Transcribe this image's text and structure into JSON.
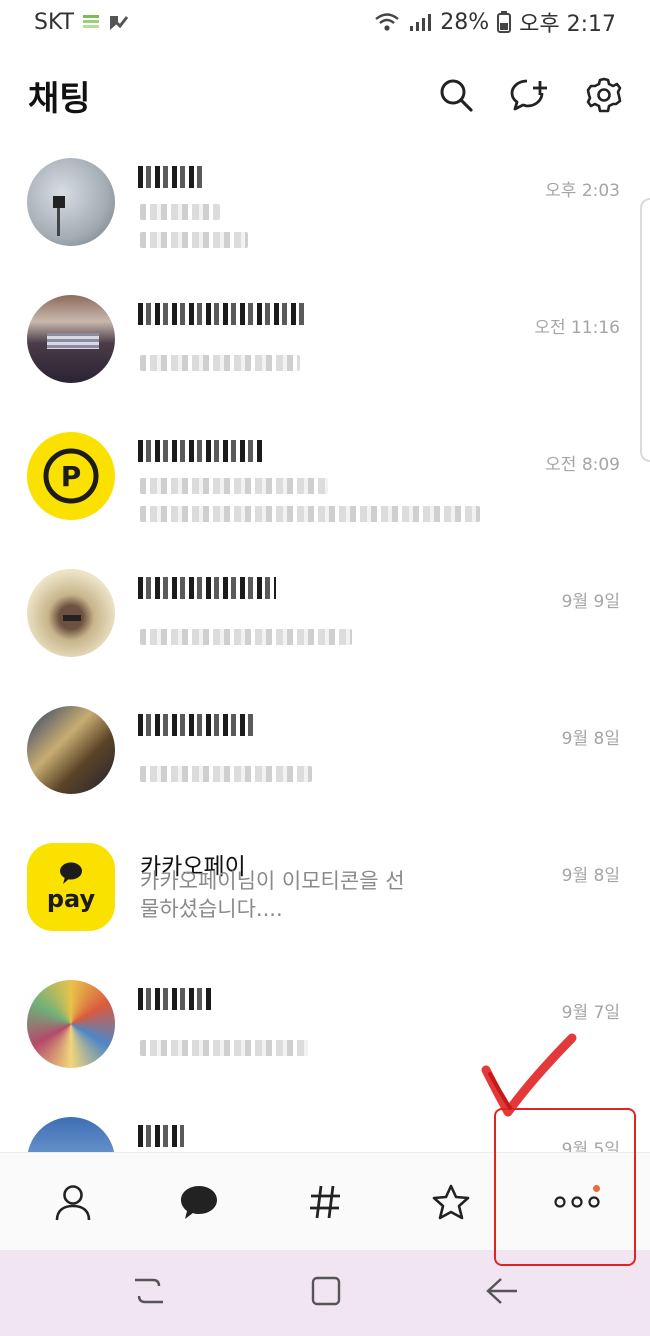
{
  "status_bar": {
    "carrier": "SKT",
    "battery": "28%",
    "time": "오후 2:17"
  },
  "header": {
    "title": "채팅"
  },
  "chats": [
    {
      "name": "",
      "preview": "",
      "time": "오후 2:03",
      "avatar": "blurred-photo-gray"
    },
    {
      "name": "",
      "preview": "",
      "time": "오전 11:16",
      "avatar": "blurred-photo-people"
    },
    {
      "name": "",
      "preview": "",
      "time": "오전 8:09",
      "avatar": "yellow-p-logo"
    },
    {
      "name": "",
      "preview": "",
      "time": "9월 9일",
      "avatar": "blurred-photo-person"
    },
    {
      "name": "",
      "preview": "",
      "time": "9월 8일",
      "avatar": "blurred-photo-dark"
    },
    {
      "name": "카카오페이",
      "preview": "카카오페이님이 이모티콘을 선물하셨습니다....",
      "time": "9월 8일",
      "avatar": "kakaopay-logo",
      "logo_text": "pay"
    },
    {
      "name": "",
      "preview": "",
      "time": "9월 7일",
      "avatar": "blurred-photo-colorful"
    },
    {
      "name": "",
      "preview": "",
      "time": "9월 5일",
      "avatar": "blurred-photo-blue"
    }
  ],
  "bottom_nav": [
    "friends-icon",
    "chats-icon",
    "hashtag-icon",
    "star-icon",
    "more-icon"
  ],
  "colors": {
    "annotation": "#e02323",
    "kakao_yellow": "#fae100",
    "new_dot": "#ea6a3c",
    "system_nav_bg": "#f0e5f0"
  }
}
